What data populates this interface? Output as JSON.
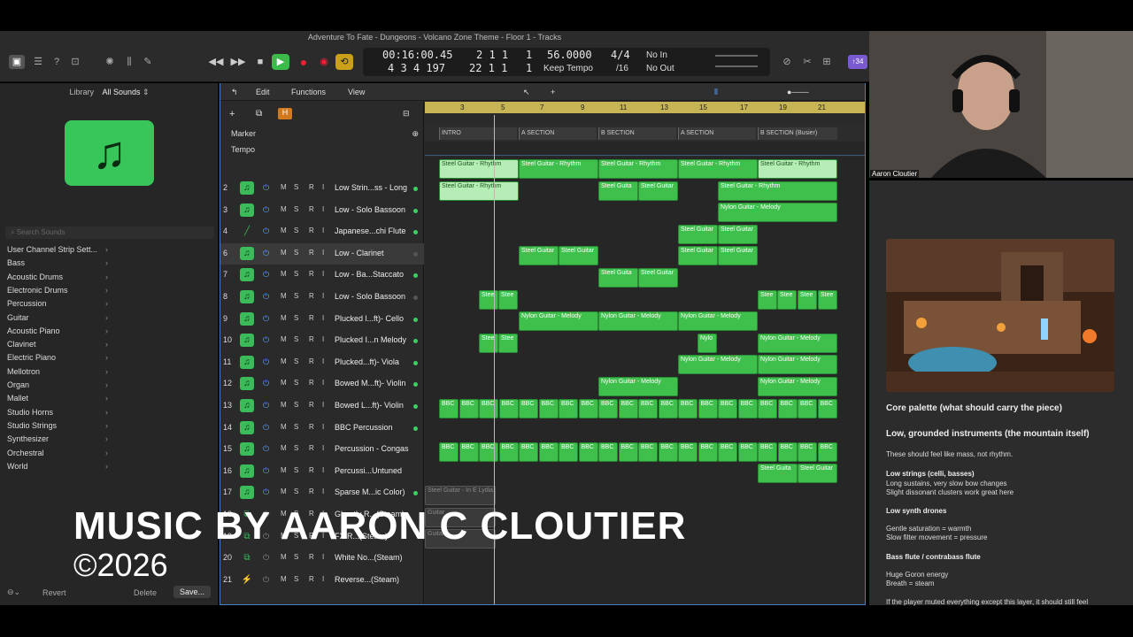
{
  "window": {
    "title": "Adventure To Fate - Dungeons - Volcano Zone Theme - Floor 1 - Tracks"
  },
  "lcd": {
    "time": "00:16:00.45",
    "bars": "4 3 4 197",
    "pos1": "2 1 1",
    "pos1b": "1",
    "pos2": "22 1 1",
    "pos2b": "1",
    "tempo": "56.0000",
    "tempo_mode": "Keep Tempo",
    "sig": "4/4",
    "div": "/16",
    "in": "No In",
    "out": "No Out"
  },
  "library": {
    "title": "Library",
    "filter": "All Sounds",
    "search_placeholder": "Search Sounds",
    "categories": [
      "User Channel Strip Sett...",
      "Bass",
      "Acoustic Drums",
      "Electronic Drums",
      "Percussion",
      "Guitar",
      "Acoustic Piano",
      "Clavinet",
      "Electric Piano",
      "Mellotron",
      "Organ",
      "Mallet",
      "Studio Horns",
      "Studio Strings",
      "Synthesizer",
      "Orchestral",
      "World"
    ],
    "revert": "Revert",
    "delete": "Delete",
    "save": "Save..."
  },
  "tracks_toolbar": {
    "edit": "Edit",
    "functions": "Functions",
    "view": "View"
  },
  "global": {
    "marker": "Marker",
    "tempo": "Tempo"
  },
  "markers": [
    "INTRO",
    "A SECTION",
    "B SECTION",
    "A SECTION",
    "B SECTION (Busier)"
  ],
  "bars": [
    "3",
    "5",
    "7",
    "9",
    "11",
    "13",
    "15",
    "17",
    "19",
    "21"
  ],
  "tracks": [
    {
      "num": "2",
      "name": "Low Strin...ss - Long"
    },
    {
      "num": "3",
      "name": "Low - Solo Bassoon"
    },
    {
      "num": "4",
      "name": "Japanese...chi Flute"
    },
    {
      "num": "6",
      "name": "Low - Clarinet"
    },
    {
      "num": "7",
      "name": "Low - Ba...Staccato"
    },
    {
      "num": "8",
      "name": "Low - Solo Bassoon"
    },
    {
      "num": "9",
      "name": "Plucked l...ft)- Cello"
    },
    {
      "num": "10",
      "name": "Plucked I...n Melody"
    },
    {
      "num": "11",
      "name": "Plucked...ft)- Viola"
    },
    {
      "num": "12",
      "name": "Bowed M...ft)- Violin"
    },
    {
      "num": "13",
      "name": "Bowed L...ft)- Violin"
    },
    {
      "num": "14",
      "name": "BBC Percussion"
    },
    {
      "num": "15",
      "name": "Percussion - Congas"
    },
    {
      "num": "16",
      "name": "Percussi...Untuned"
    },
    {
      "num": "17",
      "name": "Sparse M...ic Color)"
    },
    {
      "num": "18",
      "name": "Ghostly R...(Steam)"
    },
    {
      "num": "19",
      "name": "FX R...(Steam)"
    },
    {
      "num": "20",
      "name": "White No...(Steam)"
    },
    {
      "num": "21",
      "name": "Reverse...(Steam)"
    }
  ],
  "regions": {
    "rhythm": "Steel Guitar - Rhythm",
    "sg": "Steel Guitar",
    "sg_short": "Steel Guita",
    "sg_tiny": "Stee",
    "melody": "Nylon Guitar - Melody",
    "nylo": "Nylo",
    "bbc": "BBC",
    "steam": "Steel Guitar - In E Lydia",
    "guita": "Guitar"
  },
  "camera": {
    "name": "Aaron Cloutier"
  },
  "notes": {
    "h1": "Core palette (what should carry the piece)",
    "h2": "Low, grounded instruments (the mountain itself)",
    "p1": "These should feel like mass, not rhythm.",
    "s1": "Low strings (celli, basses)",
    "s1a": "Long sustains, very slow bow changes",
    "s1b": "Slight dissonant clusters work great here",
    "s2": "Low synth drones",
    "s2a": "Gentle saturation = warmth",
    "s2b": "Slow filter movement = pressure",
    "s3": "Bass flute / contrabass flute",
    "s3a": "Huge Goron energy",
    "s3b": "Breath = steam",
    "s3c": "If the player muted everything except this layer, it should still feel"
  },
  "overlay": {
    "credit": "MUSIC BY AARON C CLOUTIER",
    "copyright": "©2026"
  }
}
